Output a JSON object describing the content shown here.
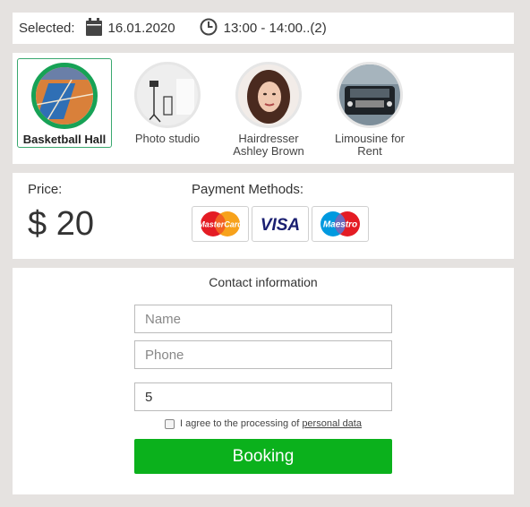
{
  "selected": {
    "label": "Selected:",
    "date": "16.01.2020",
    "time": "13:00 - 14:00..(2)",
    "calendar_icon": "calendar-icon",
    "clock_icon": "clock-icon"
  },
  "services": [
    {
      "name": "Basketball Hall",
      "image": "basketball-court-image",
      "active": true
    },
    {
      "name": "Photo studio",
      "image": "photo-studio-image",
      "active": false
    },
    {
      "name": "Hairdresser\nAshley Brown",
      "image": "hairdresser-portrait-image",
      "active": false
    },
    {
      "name": "Limousine for\nRent",
      "image": "limousine-image",
      "active": false
    }
  ],
  "pricing": {
    "price_label": "Price:",
    "price_value": "$ 20",
    "payment_label": "Payment Methods:",
    "methods": [
      "MasterCard",
      "VISA",
      "Maestro"
    ]
  },
  "contact": {
    "title": "Contact information",
    "name_placeholder": "Name",
    "phone_placeholder": "Phone",
    "third_value": "5",
    "agree_text": "I agree to the processing of",
    "agree_link": "personal data",
    "booking_label": "Booking"
  },
  "colors": {
    "accent_green": "#0bb11c",
    "selection_border": "#17a256",
    "background": "#e5e2e0"
  }
}
